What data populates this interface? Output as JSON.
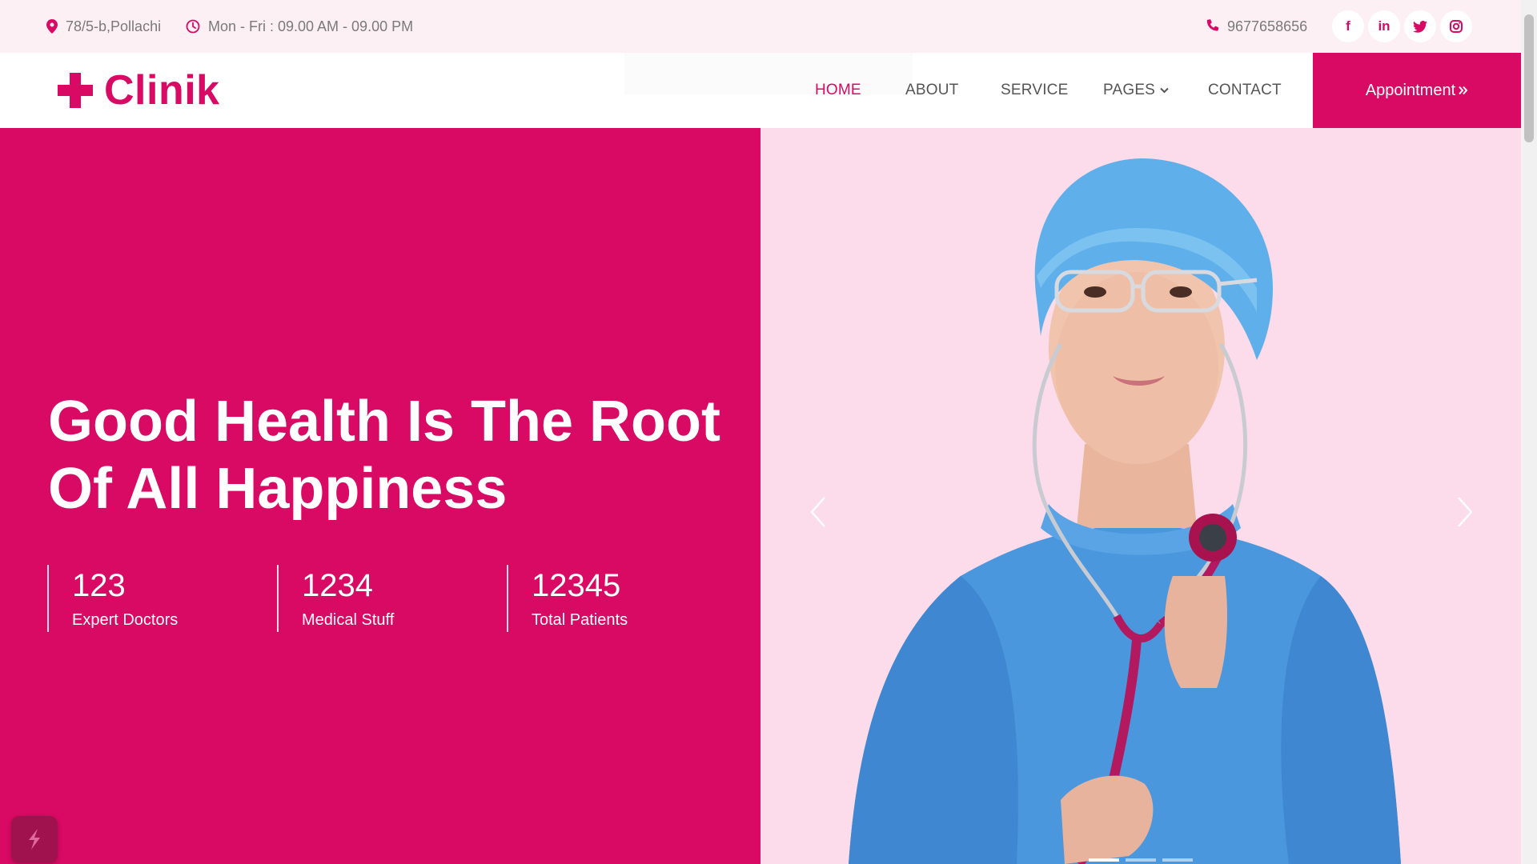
{
  "colors": {
    "brand": "#d90a64",
    "hero_bg": "#d90a64",
    "topbar_bg": "#fdf0f5",
    "photo_bg": "#fcdcea"
  },
  "topbar": {
    "address": "78/5-b,Pollachi",
    "hours": "Mon - Fri : 09.00 AM - 09.00 PM",
    "phone": "9677658656",
    "socials": [
      {
        "name": "facebook",
        "icon": "facebook-icon",
        "glyph": "f"
      },
      {
        "name": "linkedin",
        "icon": "linkedin-icon",
        "glyph": "in"
      },
      {
        "name": "twitter",
        "icon": "twitter-icon"
      },
      {
        "name": "instagram",
        "icon": "instagram-icon"
      }
    ]
  },
  "nav": {
    "brand": "Clinik",
    "links": [
      {
        "label": "HOME",
        "active": true
      },
      {
        "label": "ABOUT"
      },
      {
        "label": "SERVICE"
      },
      {
        "label": "PAGES",
        "has_dropdown": true
      },
      {
        "label": "CONTACT"
      }
    ],
    "cta": "Appointment"
  },
  "hero": {
    "title": "Good Health Is The Root Of All Happiness",
    "stats": [
      {
        "value": "123",
        "label": "Expert Doctors"
      },
      {
        "value": "1234",
        "label": "Medical Stuff"
      },
      {
        "value": "12345",
        "label": "Total Patients"
      }
    ],
    "carousel": {
      "slides": 3,
      "active_slide": 1
    }
  }
}
